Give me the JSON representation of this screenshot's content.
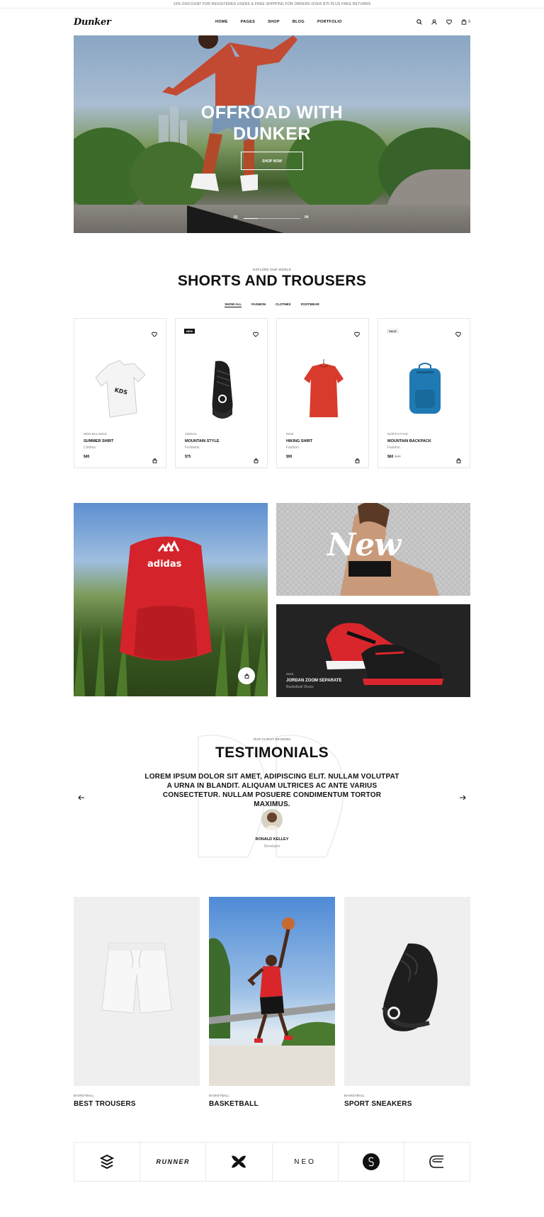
{
  "announcement": "10% DISCOUNT FOR REGISTERED USERS & FREE SHIPPING FOR ORDERS OVER $75 PLUS FREE RETURNS",
  "header": {
    "logo": "Dunker",
    "nav": [
      "HOME",
      "PAGES",
      "SHOP",
      "BLOG",
      "PORTFOLIO"
    ],
    "cart_count": "0"
  },
  "hero": {
    "title_line1": "OFFROAD WITH",
    "title_line2": "DUNKER",
    "button": "SHOP NOW",
    "slide_current": "01",
    "slide_total": "04",
    "slide_progress": 0.25
  },
  "products_section": {
    "subtitle": "EXPLORE OUR WORLD",
    "title": "SHORTS AND TROUSERS",
    "filters": [
      "SHOW ALL",
      "FASHION",
      "CLOTHES",
      "FOOTWEAR"
    ],
    "active_filter": "SHOW ALL",
    "products": [
      {
        "brand": "NEW BALANCE",
        "name": "SUMMER SHIRT",
        "category": "Clothes",
        "price": "$45",
        "old_price": "",
        "badge": ""
      },
      {
        "brand": "ADIDAS",
        "name": "MOUNTAIN STYLE",
        "category": "Footwear",
        "price": "$75",
        "old_price": "",
        "badge": "NEW"
      },
      {
        "brand": "NIKE",
        "name": "HIKING SHIRT",
        "category": "Fashion",
        "price": "$90",
        "old_price": "",
        "badge": ""
      },
      {
        "brand": "NORTH FACE",
        "name": "MOUNTAIN BACKPACK",
        "category": "Fashion",
        "price": "$60",
        "old_price": "$70",
        "badge": "SALE"
      }
    ]
  },
  "promos": {
    "left_logo": "adidas",
    "new_word": "New",
    "feature": {
      "brand": "NIKE",
      "name": "JORDAN ZOOM SEPARATE",
      "category": "Basketball Shoes"
    }
  },
  "testimonials": {
    "subtitle": "OUR CLIENT REVIEWS",
    "title": "TESTIMONIALS",
    "quote": "LOREM IPSUM DOLOR SIT AMET, ADIPISCING ELIT. NULLAM VOLUTPAT A URNA IN BLANDIT. ALIQUAM ULTRICES AC ANTE VARIUS CONSECTETUR. NULLAM POSUERE CONDIMENTUM TORTOR MAXIMUS.",
    "name": "RONALD KELLEY",
    "role": "Developer"
  },
  "categories": [
    {
      "sub": "BASKETBALL",
      "title": "BEST TROUSERS"
    },
    {
      "sub": "BASKETBALL",
      "title": "BASKETBALL"
    },
    {
      "sub": "BASKETBALL",
      "title": "SPORT SNEAKERS"
    }
  ],
  "brands": [
    "RUNNER",
    "NEO"
  ],
  "icons": [
    "search-icon",
    "user-icon",
    "heart-icon",
    "cart-icon",
    "bag-icon",
    "arrow-left-icon",
    "arrow-right-icon"
  ]
}
